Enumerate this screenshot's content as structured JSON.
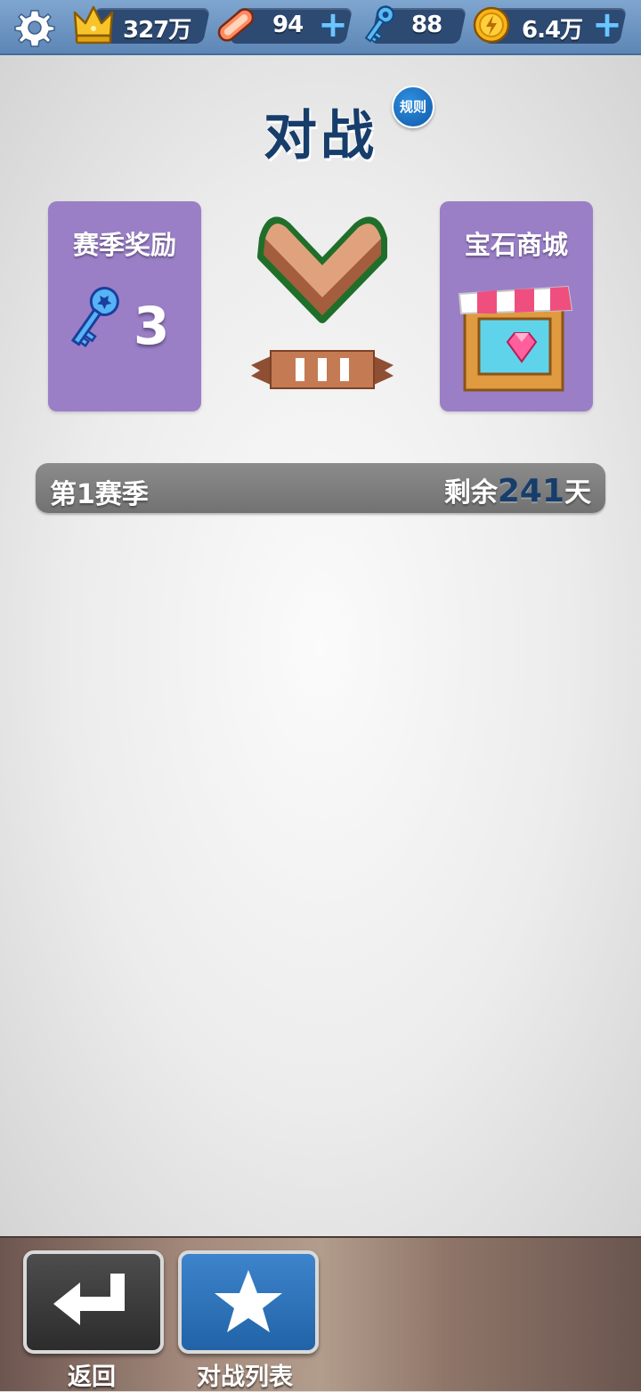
{
  "topbar": {
    "icons": [
      "gear-icon",
      "crown-icon",
      "hoverboard-icon",
      "key-icon",
      "coin-icon"
    ],
    "crowns": "327万",
    "hoverboards": "94",
    "keys": "88",
    "coins": "6.4万",
    "plus": "+"
  },
  "page": {
    "title": "对战",
    "rules_label": "规则"
  },
  "cards": {
    "season_reward": {
      "title": "赛季奖励",
      "key_count": "3"
    },
    "gem_shop": {
      "title": "宝石商城"
    }
  },
  "rank": {
    "tier": "bronze",
    "roman": "III"
  },
  "season": {
    "name": "第1赛季",
    "remaining_prefix": "剩余",
    "remaining_days": "241",
    "remaining_suffix": "天"
  },
  "bottom": {
    "back_label": "返回",
    "battle_list_label": "对战列表"
  },
  "colors": {
    "topbar": "#6d95c2",
    "title": "#173d6b",
    "card": "#9a7fc7",
    "season_bar": "#808080",
    "list_button": "#2d72b8"
  }
}
